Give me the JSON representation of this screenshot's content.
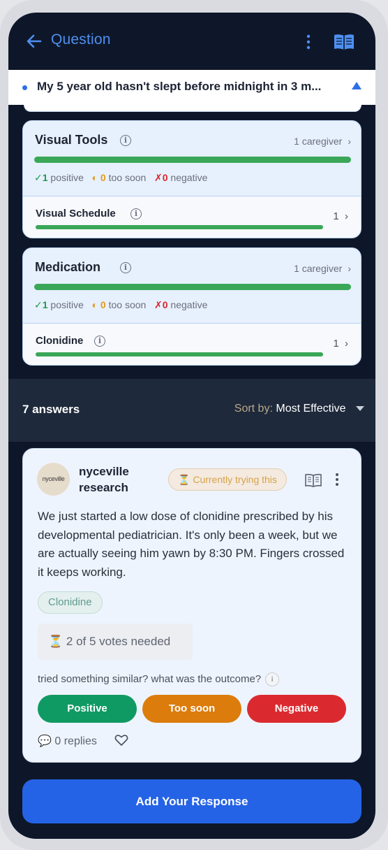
{
  "header": {
    "title": "Question",
    "back_icon": "arrow-left-icon",
    "menu_icon": "kebab-icon",
    "guide_icon": "book-icon",
    "accent": "#4e8ff0"
  },
  "question": {
    "text": "My 5 year old hasn't slept before midnight in 3 m...",
    "toggle_icon": "caret-up-icon"
  },
  "strategies": [
    {
      "title": "Visual Tools",
      "caregivers": "1 caregiver",
      "progress": 1.0,
      "positive_count": "1",
      "positive_label": "positive",
      "too_soon_count": "0",
      "too_soon_label": "too soon",
      "negative_count": "0",
      "negative_label": "negative",
      "items": [
        {
          "name": "Visual Schedule",
          "count": "1",
          "progress": 1.0
        }
      ]
    },
    {
      "title": "Medication",
      "caregivers": "1 caregiver",
      "progress": 1.0,
      "positive_count": "1",
      "positive_label": "positive",
      "too_soon_count": "0",
      "too_soon_label": "too soon",
      "negative_count": "0",
      "negative_label": "negative",
      "items": [
        {
          "name": "Clonidine",
          "count": "1",
          "progress": 1.0
        }
      ]
    }
  ],
  "answers": {
    "count_label": "7 answers",
    "sort_label": "Sort by:",
    "sort_value": "Most Effective"
  },
  "answer": {
    "avatar_text": "nyceville",
    "author": "nyceville research",
    "status": "Currently trying this",
    "body": "We just started a low dose of clonidine prescribed by his developmental pediatrician. It's only been a week, but we are actually seeing him yawn by 8:30 PM. Fingers crossed it keeps working.",
    "tag": "Clonidine",
    "votes_needed": "2 of 5 votes needed",
    "prompt": "tried something similar? what was the outcome?",
    "prompt_info": "i",
    "btn_positive": "Positive",
    "btn_too_soon": "Too soon",
    "btn_negative": "Negative",
    "replies": "0 replies",
    "colors": {
      "positive": "#109a63",
      "too_soon": "#dc7c0c",
      "negative": "#db2a2f"
    }
  },
  "cta": {
    "label": "Add Your Response",
    "color": "#2563e6"
  }
}
